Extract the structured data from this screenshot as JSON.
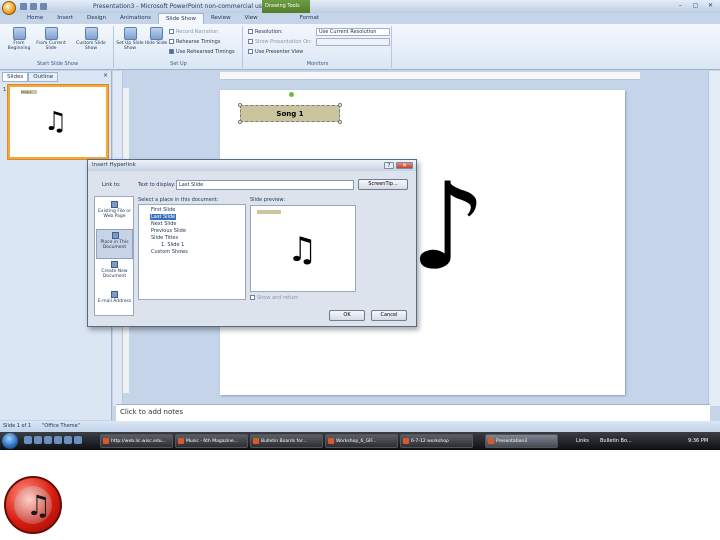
{
  "window": {
    "title": "Presentation3 - Microsoft PowerPoint non-commercial use",
    "context_tab": "Drawing Tools",
    "controls": [
      "–",
      "▢",
      "✕"
    ]
  },
  "tabs": [
    {
      "label": "Home"
    },
    {
      "label": "Insert"
    },
    {
      "label": "Design"
    },
    {
      "label": "Animations"
    },
    {
      "label": "Slide Show"
    },
    {
      "label": "Review"
    },
    {
      "label": "View"
    },
    {
      "label": "Format"
    }
  ],
  "ribbon": {
    "start_group": "Start Slide Show",
    "from_beginning": "From Beginning",
    "from_current": "From Current Slide",
    "custom_show": "Custom Slide Show",
    "setup_group": "Set Up",
    "setup_show": "Set Up Slide Show",
    "hide_slide": "Hide Slide",
    "record_narration": "Record Narration",
    "rehearse_timings": "Rehearse Timings",
    "use_rehearsed": "Use Rehearsed Timings",
    "monitors_group": "Monitors",
    "resolution_label": "Resolution:",
    "resolution_value": "Use Current Resolution",
    "show_on_label": "Show Presentation On:",
    "presenter_view": "Use Presenter View"
  },
  "left_pane": {
    "tab_slides": "Slides",
    "tab_outline": "Outline",
    "close": "×",
    "slide_number": "1",
    "thumb_button": "Song 1",
    "note_glyph": "♫"
  },
  "slide": {
    "button_text": "Song 1",
    "note_glyph": "♪"
  },
  "notes_placeholder": "Click to add notes",
  "status": {
    "slide_info": "Slide 1 of 1",
    "theme": "\"Office Theme\""
  },
  "dialog": {
    "title": "Insert Hyperlink",
    "help": "?",
    "close": "✕",
    "link_to": "Link to:",
    "text_to_display_label": "Text to display:",
    "text_to_display_value": "Last Slide",
    "screentip": "ScreenTip...",
    "select_place": "Select a place in this document:",
    "slide_preview": "Slide preview:",
    "show_and_return": "Show and return",
    "ok": "OK",
    "cancel": "Cancel",
    "link_options": [
      {
        "label": "Existing File or Web Page"
      },
      {
        "label": "Place in This Document"
      },
      {
        "label": "Create New Document"
      },
      {
        "label": "E-mail Address"
      }
    ],
    "tree": [
      {
        "label": "First Slide"
      },
      {
        "label": "Last Slide"
      },
      {
        "label": "Next Slide"
      },
      {
        "label": "Previous Slide"
      },
      {
        "label": "Slide Titles"
      },
      {
        "label": "1. Slide 1"
      },
      {
        "label": "Custom Shows"
      }
    ],
    "preview_note": "♫"
  },
  "taskbar": {
    "items": [
      {
        "label": "http://web.lic.wisc.edu..."
      },
      {
        "label": "Music - 6th Magazine..."
      },
      {
        "label": "Bulletin Boards for..."
      },
      {
        "label": "Workshop_6_GIF..."
      },
      {
        "label": "6-7-12 workshop"
      },
      {
        "label": "Presentation3"
      }
    ],
    "tray_links": "Links",
    "tray_bulletin": "Bulletin Bo...",
    "clock": "9:36 PM"
  },
  "logo": {
    "note_glyph": "♫"
  }
}
